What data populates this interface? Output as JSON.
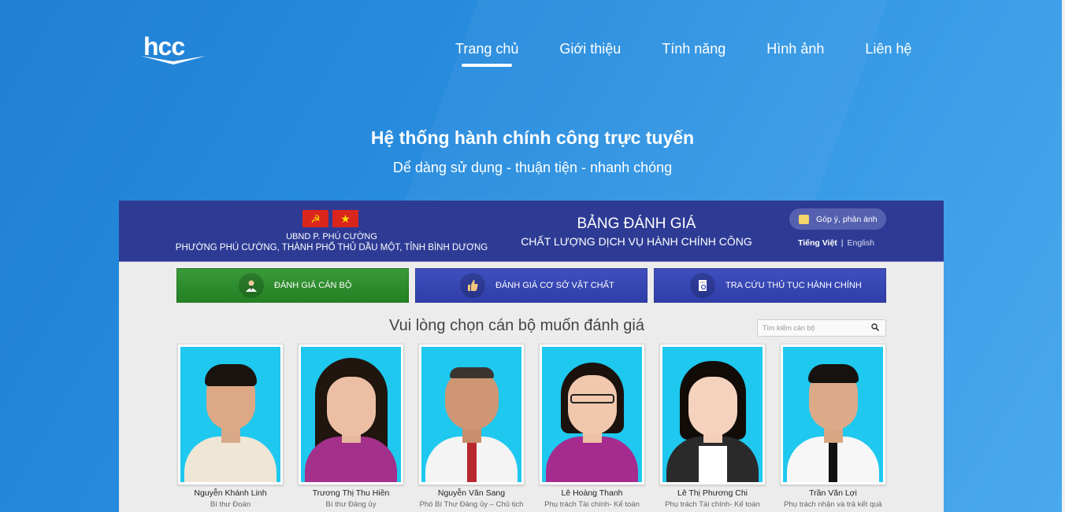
{
  "nav": {
    "items": [
      {
        "label": "Trang chủ",
        "active": true
      },
      {
        "label": "Giới thiệu",
        "active": false
      },
      {
        "label": "Tính năng",
        "active": false
      },
      {
        "label": "Hình ảnh",
        "active": false
      },
      {
        "label": "Liên hệ",
        "active": false
      }
    ]
  },
  "hero": {
    "title": "Hệ thống hành chính công trực tuyến",
    "subtitle": "Dể dàng sử dụng - thuận tiện - nhanh chóng"
  },
  "panel": {
    "org_line1": "UBND P. PHÚ CƯỜNG",
    "org_line2": "PHƯỜNG PHÚ CƯỜNG, THÀNH PHỐ THỦ DẦU MỘT, TỈNH BÌNH DƯƠNG",
    "board_title": "BẢNG ĐÁNH GIÁ",
    "board_subtitle": "CHẤT LƯỢNG DỊCH VỤ HÀNH CHÍNH CÔNG",
    "feedback_label": "Góp ý, phản ánh",
    "lang_vi": "Tiếng Việt",
    "lang_sep": "|",
    "lang_en": "English",
    "tabs": [
      {
        "label": "ĐÁNH GIÁ CÁN BỘ",
        "icon": "staff-icon"
      },
      {
        "label": "ĐÁNH GIÁ CƠ SỞ VẬT CHẤT",
        "icon": "thumbs-up-icon"
      },
      {
        "label": "TRA CỨU THỦ TỤC HÀNH CHÍNH",
        "icon": "document-search-icon"
      }
    ],
    "pick_title": "Vui lòng chọn cán bộ muốn đánh giá",
    "search_placeholder": "Tìm kiếm cán bộ",
    "staff": [
      {
        "name": "Nguyễn Khánh Linh",
        "role": "Bí thư Đoàn"
      },
      {
        "name": "Trương Thị Thu Hiền",
        "role": "Bí thư Đảng ủy"
      },
      {
        "name": "Nguyễn Văn Sang",
        "role": "Phó Bí Thư Đảng ủy – Chủ tịch"
      },
      {
        "name": "Lê Hoàng Thanh",
        "role": "Phụ trách Tài chính- Kế toán"
      },
      {
        "name": "Lê Thị Phương Chi",
        "role": "Phụ trách Tài chính- Kế toán"
      },
      {
        "name": "Trần Văn Lợi",
        "role": "Phụ trách nhận và trả kết quả"
      }
    ]
  },
  "colors": {
    "panel_header": "#2e3b95",
    "tab_green": "#238023",
    "tab_blue": "#2f3ea8",
    "photo_bg": "#1ec8ef"
  }
}
